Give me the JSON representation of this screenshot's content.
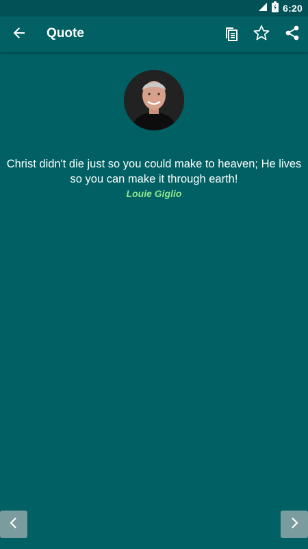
{
  "status_bar": {
    "time": "6:20",
    "icons": [
      "signal-icon",
      "battery-charging-icon"
    ]
  },
  "app_bar": {
    "title": "Quote",
    "actions": [
      "copy-icon",
      "star-outline-icon",
      "share-icon"
    ]
  },
  "quote": {
    "text": "Christ didn't die just so you could make to heaven; He lives so you can make it through earth!",
    "author": "Louie Giglio"
  },
  "navigation": {
    "previous_icon": "chevron-left-icon",
    "next_icon": "chevron-right-icon"
  },
  "colors": {
    "background": "#006064",
    "status_bar": "#005257",
    "author": "#8fe88c",
    "nav_button": "#7a9c9e"
  }
}
